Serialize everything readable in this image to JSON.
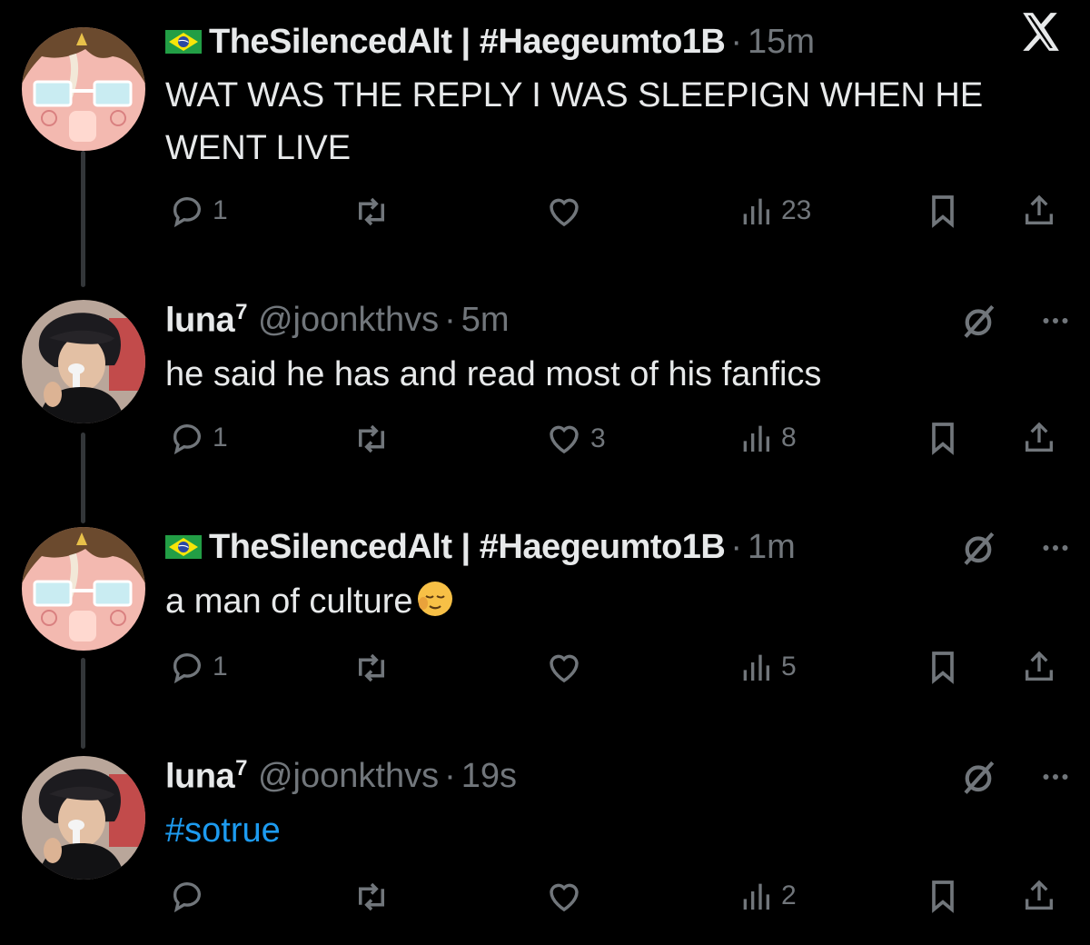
{
  "brand": {
    "logo_icon": "x-logo-icon"
  },
  "colors": {
    "background": "#000000",
    "text": "#e7e9ea",
    "muted": "#71767b",
    "link": "#1d9bf0"
  },
  "tweets": [
    {
      "display_name": "TheSilencedAlt | #Haegeumto1B",
      "handle": "",
      "time": "15m",
      "text": "WAT WAS THE REPLY I WAS SLEEPIGN WHEN HE WENT LIVE",
      "replies": "1",
      "reposts": "",
      "likes": "",
      "views": "23"
    },
    {
      "display_name": "luna",
      "name_suffix": "7",
      "handle": "@joonkthvs",
      "time": "5m",
      "text": "he said he has and read most of his fanfics",
      "replies": "1",
      "reposts": "",
      "likes": "3",
      "views": "8"
    },
    {
      "display_name": "TheSilencedAlt | #Haegeumto1B",
      "handle": "",
      "time": "1m",
      "text": "a man of culture",
      "replies": "1",
      "reposts": "",
      "likes": "",
      "views": "5"
    },
    {
      "display_name": "luna",
      "name_suffix": "7",
      "handle": "@joonkthvs",
      "time": "19s",
      "text": "#sotrue",
      "replies": "",
      "reposts": "",
      "likes": "",
      "views": "2"
    }
  ]
}
